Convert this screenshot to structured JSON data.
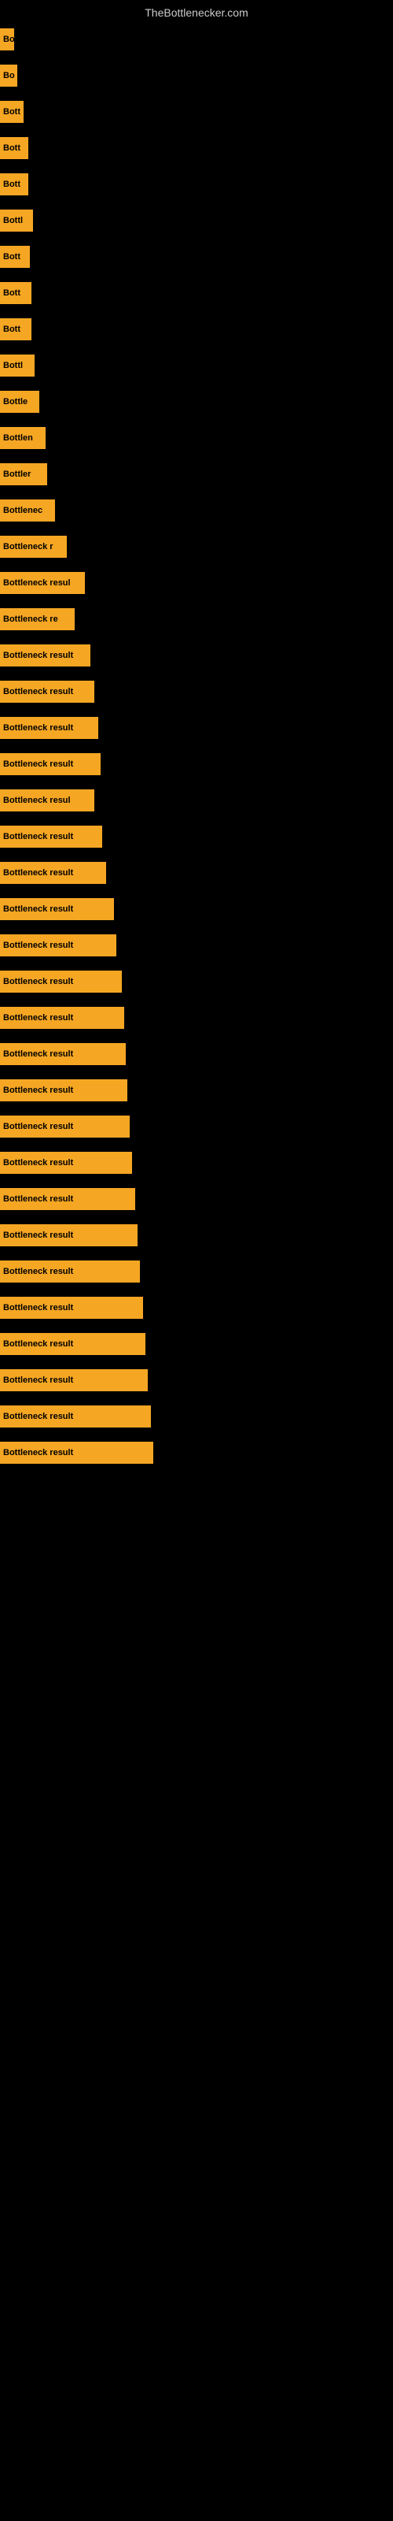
{
  "site": {
    "title": "TheBottlenecker.com"
  },
  "bars": [
    {
      "label": "Bo",
      "width": 18
    },
    {
      "label": "Bo",
      "width": 22
    },
    {
      "label": "Bott",
      "width": 30
    },
    {
      "label": "Bott",
      "width": 36
    },
    {
      "label": "Bott",
      "width": 36
    },
    {
      "label": "Bottl",
      "width": 42
    },
    {
      "label": "Bott",
      "width": 38
    },
    {
      "label": "Bott",
      "width": 40
    },
    {
      "label": "Bott",
      "width": 40
    },
    {
      "label": "Bottl",
      "width": 44
    },
    {
      "label": "Bottle",
      "width": 50
    },
    {
      "label": "Bottlen",
      "width": 58
    },
    {
      "label": "Bottler",
      "width": 60
    },
    {
      "label": "Bottlenec",
      "width": 70
    },
    {
      "label": "Bottleneck r",
      "width": 85
    },
    {
      "label": "Bottleneck resul",
      "width": 108
    },
    {
      "label": "Bottleneck re",
      "width": 95
    },
    {
      "label": "Bottleneck result",
      "width": 115
    },
    {
      "label": "Bottleneck result",
      "width": 120
    },
    {
      "label": "Bottleneck result",
      "width": 125
    },
    {
      "label": "Bottleneck result",
      "width": 128
    },
    {
      "label": "Bottleneck resul",
      "width": 120
    },
    {
      "label": "Bottleneck result",
      "width": 130
    },
    {
      "label": "Bottleneck result",
      "width": 135
    },
    {
      "label": "Bottleneck result",
      "width": 145
    },
    {
      "label": "Bottleneck result",
      "width": 148
    },
    {
      "label": "Bottleneck result",
      "width": 155
    },
    {
      "label": "Bottleneck result",
      "width": 158
    },
    {
      "label": "Bottleneck result",
      "width": 160
    },
    {
      "label": "Bottleneck result",
      "width": 162
    },
    {
      "label": "Bottleneck result",
      "width": 165
    },
    {
      "label": "Bottleneck result",
      "width": 168
    },
    {
      "label": "Bottleneck result",
      "width": 172
    },
    {
      "label": "Bottleneck result",
      "width": 175
    },
    {
      "label": "Bottleneck result",
      "width": 178
    },
    {
      "label": "Bottleneck result",
      "width": 182
    },
    {
      "label": "Bottleneck result",
      "width": 185
    },
    {
      "label": "Bottleneck result",
      "width": 188
    },
    {
      "label": "Bottleneck result",
      "width": 192
    },
    {
      "label": "Bottleneck result",
      "width": 195
    }
  ]
}
